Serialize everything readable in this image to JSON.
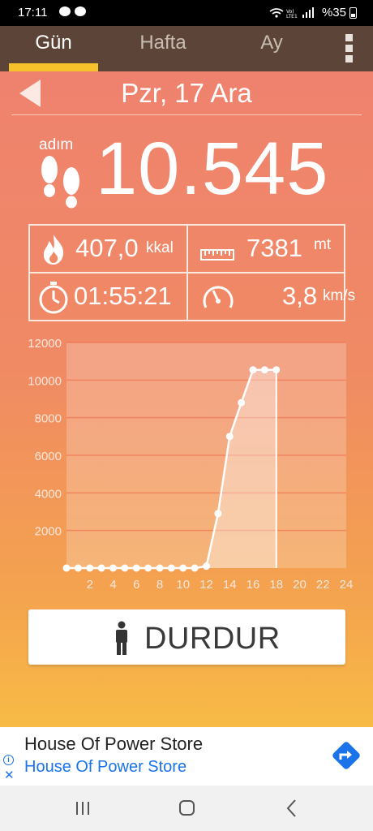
{
  "status_bar": {
    "time": "17:11",
    "battery_text": "%35"
  },
  "tabs": [
    {
      "label": "Gün",
      "active": true
    },
    {
      "label": "Hafta",
      "active": false
    },
    {
      "label": "Ay",
      "active": false
    }
  ],
  "date": {
    "label": "Pzr, 17 Ara"
  },
  "steps": {
    "label": "adım",
    "value": "10.545"
  },
  "stats": {
    "calories": {
      "value": "407,0",
      "unit": "kkal"
    },
    "distance": {
      "value": "7381",
      "unit": "mt"
    },
    "duration": {
      "value": "01:55:21",
      "unit": ""
    },
    "speed": {
      "value": "3,8",
      "unit": "km/s"
    }
  },
  "chart_data": {
    "type": "line",
    "x": [
      0,
      1,
      2,
      3,
      4,
      5,
      6,
      7,
      8,
      9,
      10,
      11,
      12,
      13,
      14,
      15,
      16,
      17,
      18
    ],
    "y": [
      0,
      0,
      0,
      0,
      0,
      0,
      0,
      0,
      0,
      0,
      0,
      0,
      100,
      2900,
      7000,
      8800,
      10545,
      10545,
      10545
    ],
    "xticks": [
      2,
      4,
      6,
      8,
      10,
      12,
      14,
      16,
      18,
      20,
      22,
      24
    ],
    "yticks": [
      2000,
      4000,
      6000,
      8000,
      10000,
      12000
    ],
    "xlim": [
      0,
      24
    ],
    "ylim": [
      0,
      12000
    ],
    "grid": true,
    "title": "",
    "xlabel": "",
    "ylabel": ""
  },
  "stop_button": {
    "label": "DURDUR"
  },
  "ad": {
    "title": "House Of Power Store",
    "subtitle": "House Of Power Store",
    "info_glyph": "i",
    "close_glyph": "✕"
  },
  "colors": {
    "tab_bar": "#5c4538",
    "tab_indicator": "#f5c22b",
    "ad_link": "#1a73e8"
  }
}
